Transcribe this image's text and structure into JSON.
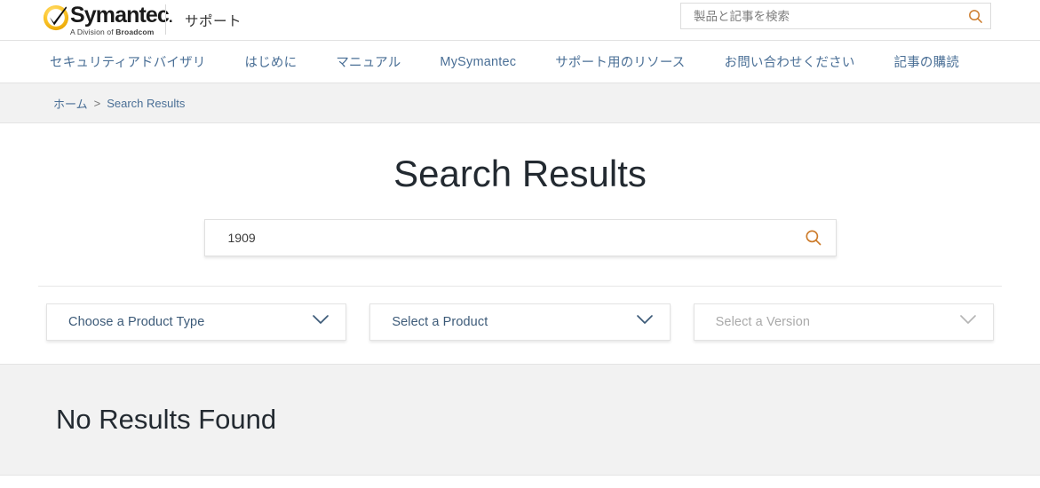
{
  "header": {
    "logo": {
      "brand": "Symantec",
      "brand_dot": ".",
      "tagline_prefix": "A Division of ",
      "tagline_brand": "Broadcom",
      "check_icon": "symantec-check-icon"
    },
    "support_label": "サポート",
    "search": {
      "placeholder": "製品と記事を検索",
      "value": "",
      "icon": "search-icon",
      "icon_color": "#cc7a29"
    }
  },
  "nav": {
    "items": [
      {
        "label": "セキュリティアドバイザリ"
      },
      {
        "label": "はじめに"
      },
      {
        "label": "マニュアル"
      },
      {
        "label": "MySymantec"
      },
      {
        "label": "サポート用のリソース"
      },
      {
        "label": "お問い合わせください"
      },
      {
        "label": "記事の購読"
      }
    ]
  },
  "breadcrumb": {
    "home": "ホーム",
    "separator": ">",
    "current": "Search Results"
  },
  "main": {
    "title": "Search Results",
    "search": {
      "value": "1909",
      "placeholder": "",
      "icon": "search-icon",
      "icon_color": "#cc7a29"
    },
    "filters": [
      {
        "label": "Choose a Product Type",
        "name": "product-type",
        "disabled": false
      },
      {
        "label": "Select a Product",
        "name": "product",
        "disabled": false
      },
      {
        "label": "Select a Version",
        "name": "version",
        "disabled": true
      }
    ],
    "results": {
      "empty_message": "No Results Found"
    }
  },
  "colors": {
    "link_blue": "#4a6f96",
    "accent_orange": "#cc7a29",
    "band_gray": "#f2f2f2",
    "text_dark": "#232a31"
  }
}
